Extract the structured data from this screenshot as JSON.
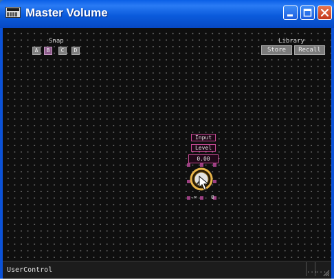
{
  "window": {
    "title": "Master Volume"
  },
  "titlebar_buttons": {
    "minimize": "minimize-icon",
    "maximize": "maximize-icon",
    "close": "close-icon"
  },
  "snap": {
    "label": "Snap",
    "buttons": [
      "A",
      "B",
      "C",
      "D"
    ],
    "active": "B"
  },
  "library": {
    "label": "Library",
    "store": "Store",
    "recall": "Recall"
  },
  "control": {
    "input_label": "Input",
    "level_label": "Level",
    "value": "0.00",
    "range_min": "-∞",
    "range_max": "0"
  },
  "status": {
    "text": "UserControl",
    "pane1": "...",
    "pane2": "..."
  },
  "colors": {
    "title_bar": "#0b5bdc",
    "canvas": "#0f0f0f",
    "selection": "#c74a94",
    "knob": "#e8b54a"
  }
}
